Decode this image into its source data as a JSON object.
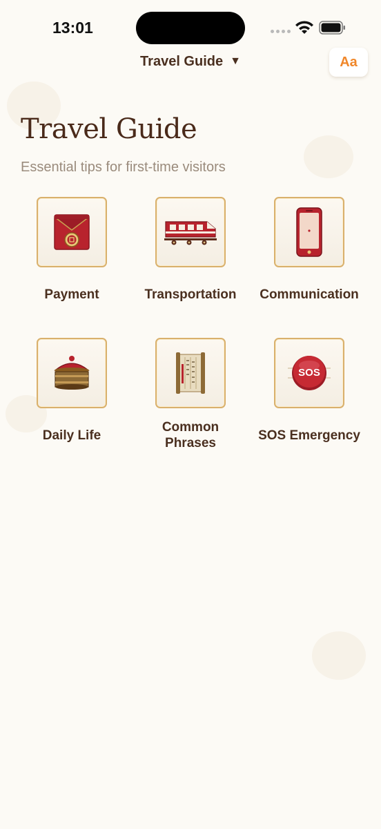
{
  "status_bar": {
    "time": "13:01"
  },
  "header": {
    "nav_title": "Travel Guide",
    "dropdown_glyph": "▼",
    "font_button_label": "Aa"
  },
  "page": {
    "title": "Travel Guide",
    "subtitle": "Essential tips for first-time visitors"
  },
  "categories": [
    {
      "label": "Payment",
      "icon": "red-envelope-icon"
    },
    {
      "label": "Transportation",
      "icon": "train-icon"
    },
    {
      "label": "Communication",
      "icon": "smartphone-icon"
    },
    {
      "label": "Daily Life",
      "icon": "steamer-basket-icon"
    },
    {
      "label": "Common\nPhrases",
      "icon": "bamboo-scroll-icon"
    },
    {
      "label": "SOS Emergency",
      "icon": "sos-button-icon",
      "icon_text": "SOS"
    }
  ],
  "colors": {
    "background": "#fcfaf5",
    "accent": "#f0872a",
    "text_primary": "#4a2f1f",
    "text_secondary": "#9a8b7c",
    "tile_border": "#d9b06c",
    "icon_red": "#b8232d"
  }
}
